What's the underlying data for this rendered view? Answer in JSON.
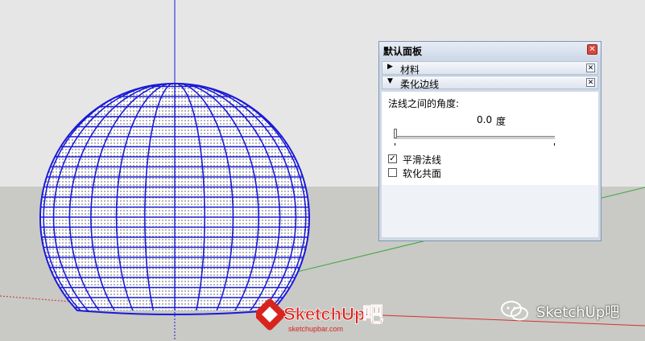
{
  "panel": {
    "title": "默认面板",
    "sections": [
      {
        "label": "材料",
        "expanded": false
      },
      {
        "label": "柔化边线",
        "expanded": true
      }
    ],
    "soften": {
      "angle_label": "法线之间的角度:",
      "angle_value": "0.0",
      "angle_unit": "度",
      "angle_slider_fraction": 0.0,
      "smooth_normals_label": "平滑法线",
      "smooth_normals_checked": true,
      "soften_coplanar_label": "软化共面",
      "soften_coplanar_checked": false
    }
  },
  "watermark": {
    "logo_text": "SketchUp",
    "logo_suffix": "吧",
    "logo_url_text": "sketchupbar.com",
    "wechat_text": "SketchUp吧"
  },
  "colors": {
    "sky": "#e6e6e6",
    "ground": "#c9c9c5",
    "mesh": "#1a1ad8",
    "axis_green": "#3aa83a",
    "axis_red": "#d23232",
    "axis_blue": "#1a1ad8",
    "logo_red": "#d8241d"
  }
}
